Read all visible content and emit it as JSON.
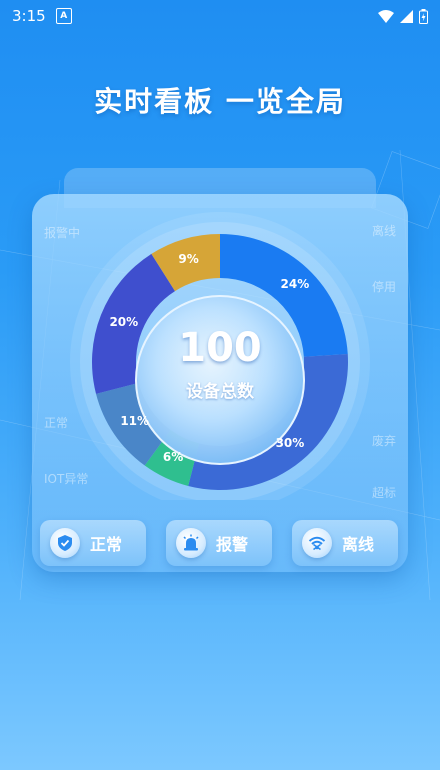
{
  "status_bar": {
    "time": "3:15",
    "app_badge": "A"
  },
  "headline": "实时看板  一览全局",
  "card": {
    "side_labels": {
      "top_left": "报警中",
      "top_right": "离线",
      "right_2": "停用",
      "left_mid": "正常",
      "left_low": "IOT异常",
      "right_low": "废弃",
      "right_bottom": "超标"
    }
  },
  "chart_data": {
    "type": "pie",
    "center_value": "100",
    "center_label": "设备总数",
    "slices": [
      {
        "label": "24%",
        "value": 24,
        "color": "#1a7bf2"
      },
      {
        "label": "30%",
        "value": 30,
        "color": "#3b6ad6"
      },
      {
        "label": "6%",
        "value": 6,
        "color": "#2fbf8f"
      },
      {
        "label": "11%",
        "value": 11,
        "color": "#4a86c8"
      },
      {
        "label": "20%",
        "value": 20,
        "color": "#3f4fce"
      },
      {
        "label": "9%",
        "value": 9,
        "color": "#d6a537"
      }
    ]
  },
  "buttons": [
    {
      "label": "正常",
      "icon": "shield-check-icon"
    },
    {
      "label": "报警",
      "icon": "alarm-siren-icon"
    },
    {
      "label": "离线",
      "icon": "wifi-off-icon"
    }
  ]
}
